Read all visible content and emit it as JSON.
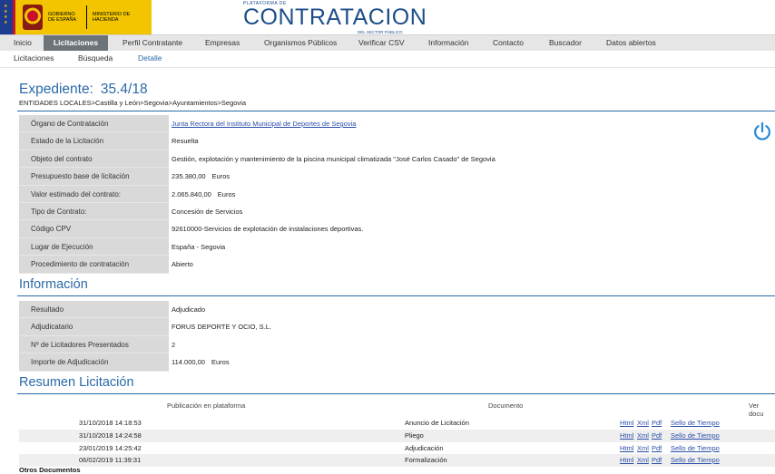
{
  "header": {
    "gov_text": "GOBIERNO DE ESPAÑA",
    "ministry_text": "MINISTERIO DE HACIENDA",
    "platform_small": "PLATAFORMA DE",
    "platform_big": "CONTRATACION",
    "platform_sub": "DEL SECTOR PÚBLICO"
  },
  "nav": {
    "items": [
      "Inicio",
      "Licitaciones",
      "Perfil Contratante",
      "Empresas",
      "Organismos Públicos",
      "Verificar CSV",
      "Información",
      "Contacto",
      "Buscador",
      "Datos abiertos"
    ],
    "active": "Licitaciones"
  },
  "subnav": {
    "items": [
      "Licitaciones",
      "Búsqueda",
      "Detalle"
    ],
    "current": "Detalle"
  },
  "expediente": {
    "label": "Expediente:",
    "number": "35.4/18",
    "breadcrumb": "ENTIDADES LOCALES>Castilla y León>Segovia>Ayuntamientos>Segovia"
  },
  "details": [
    {
      "label": "Órgano de Contratación",
      "value": "Junta Rectora del Instituto Municipal de Deportes de Segovia",
      "link": true
    },
    {
      "label": "Estado de la Licitación",
      "value": "Resuelta"
    },
    {
      "label": "Objeto del contrato",
      "value": "Gestión, explotación y mantenimiento de la piscina municipal climatizada \"José Carlos Casado\" de Segovia"
    },
    {
      "label": "Presupuesto base de licitación",
      "value": "235.380,00",
      "unit": "Euros"
    },
    {
      "label": "Valor estimado del contrato:",
      "value": "2.065.840,00",
      "unit": "Euros"
    },
    {
      "label": "Tipo de Contrato:",
      "value": "Concesión de Servicios"
    },
    {
      "label": "Código CPV",
      "value": "92610000-Servicios de explotación de instalaciones deportivas."
    },
    {
      "label": "Lugar de Ejecución",
      "value": "España - Segovia"
    },
    {
      "label": "Procedimiento de contratación",
      "value": "Abierto"
    }
  ],
  "informacion": {
    "title": "Información",
    "rows": [
      {
        "label": "Resultado",
        "value": "Adjudicado"
      },
      {
        "label": "Adjudicatario",
        "value": "FORUS DEPORTE Y OCIO, S.L."
      },
      {
        "label": "Nº de Licitadores Presentados",
        "value": "2"
      },
      {
        "label": "Importe de Adjudicación",
        "value": "114.000,00",
        "unit": "Euros"
      }
    ]
  },
  "resumen": {
    "title": "Resumen Licitación",
    "headers": {
      "publicacion": "Publicación en plataforma",
      "documento": "Documento",
      "ver": "Ver docu"
    },
    "rows": [
      {
        "fecha": "31/10/2018 14:18:53",
        "documento": "Anuncio de Licitación"
      },
      {
        "fecha": "31/10/2018 14:24:58",
        "documento": "Pliego"
      },
      {
        "fecha": "23/01/2019 14:25:42",
        "documento": "Adjudicación"
      },
      {
        "fecha": "06/02/2019 11:39:31",
        "documento": "Formalización"
      }
    ],
    "links": {
      "html": "Html",
      "xml": "Xml",
      "pdf": "Pdf",
      "sello": "Sello de Tiempo"
    }
  },
  "otros_documentos": "Otros Documentos",
  "icons": {
    "power": "power-icon"
  },
  "colors": {
    "accent": "#2a6aa8",
    "nav_active": "#6d7479",
    "gov_yellow": "#f2c500"
  }
}
